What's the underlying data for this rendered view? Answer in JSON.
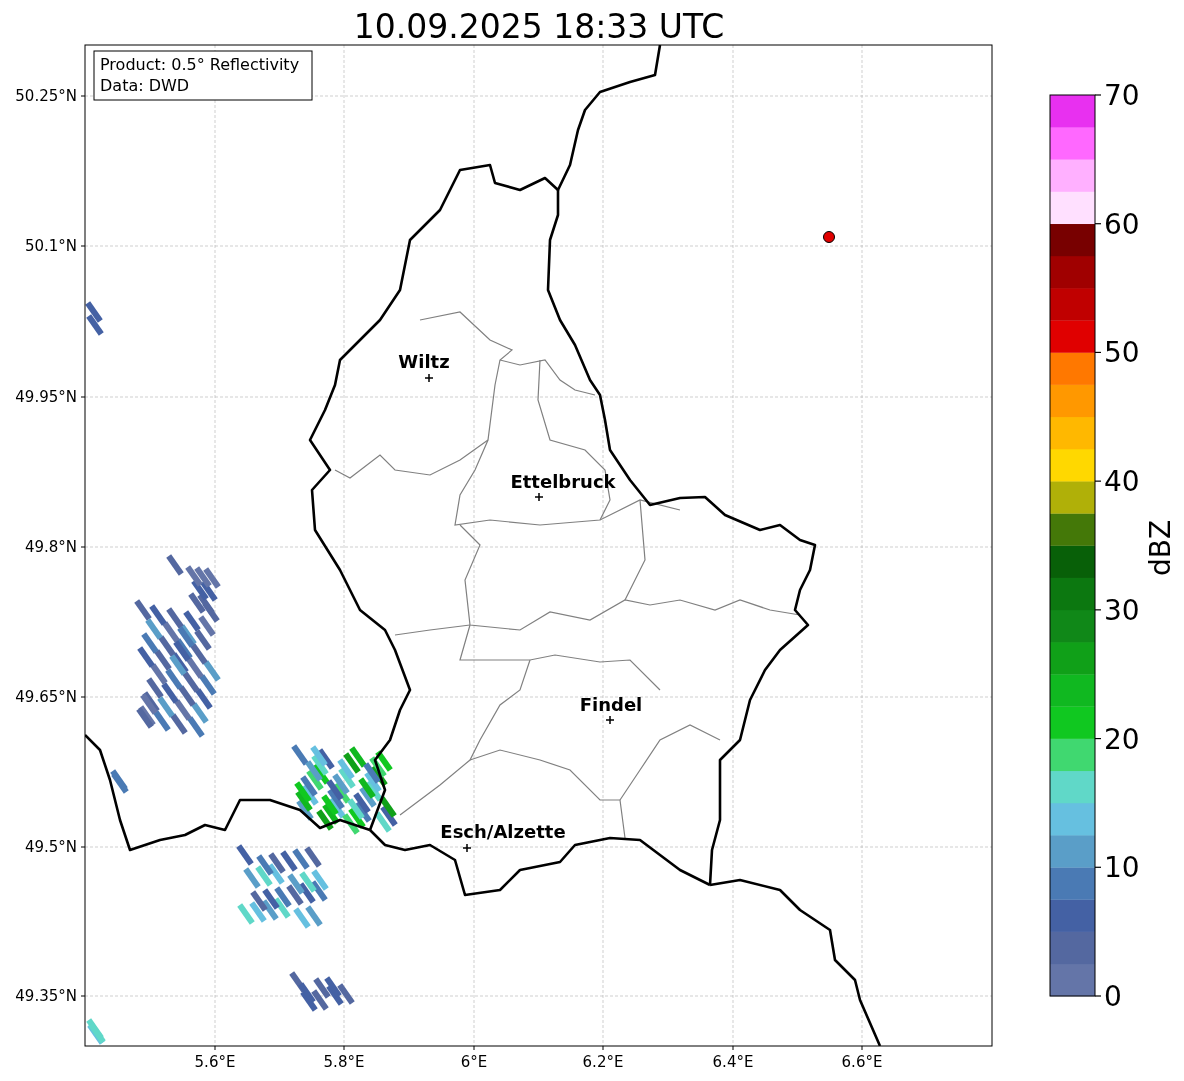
{
  "title": "10.09.2025 18:33 UTC",
  "info_box": [
    "Product: 0.5° Reflectivity",
    "Data: DWD"
  ],
  "map": {
    "x_ticks": [
      "5.6°E",
      "5.8°E",
      "6°E",
      "6.2°E",
      "6.4°E",
      "6.6°E"
    ],
    "y_ticks": [
      "50.25°N",
      "50.1°N",
      "49.95°N",
      "49.8°N",
      "49.65°N",
      "49.5°N",
      "49.35°N"
    ],
    "cities": [
      {
        "name": "Wiltz"
      },
      {
        "name": "Ettelbruck"
      },
      {
        "name": "Findel"
      },
      {
        "name": "Esch/Alzette"
      }
    ]
  },
  "colorbar": {
    "label": "dBZ",
    "ticks": [
      "70",
      "60",
      "50",
      "40",
      "30",
      "20",
      "10",
      "0"
    ],
    "bins": [
      {
        "color": "#6475a8"
      },
      {
        "color": "#5468a0"
      },
      {
        "color": "#4461a4"
      },
      {
        "color": "#4a7ab4"
      },
      {
        "color": "#5a9ec8"
      },
      {
        "color": "#66c0e0"
      },
      {
        "color": "#60d8c8"
      },
      {
        "color": "#40d870"
      },
      {
        "color": "#10c820"
      },
      {
        "color": "#10b820"
      },
      {
        "color": "#10a018"
      },
      {
        "color": "#108818"
      },
      {
        "color": "#0c7810"
      },
      {
        "color": "#086008"
      },
      {
        "color": "#447808"
      },
      {
        "color": "#b0b008"
      },
      {
        "color": "#ffd800"
      },
      {
        "color": "#ffb800"
      },
      {
        "color": "#ff9800"
      },
      {
        "color": "#ff7800"
      },
      {
        "color": "#e00000"
      },
      {
        "color": "#c00000"
      },
      {
        "color": "#a00000"
      },
      {
        "color": "#780000"
      },
      {
        "color": "#ffe0ff"
      },
      {
        "color": "#ffb0ff"
      },
      {
        "color": "#ff68ff"
      },
      {
        "color": "#e830f0"
      }
    ]
  }
}
